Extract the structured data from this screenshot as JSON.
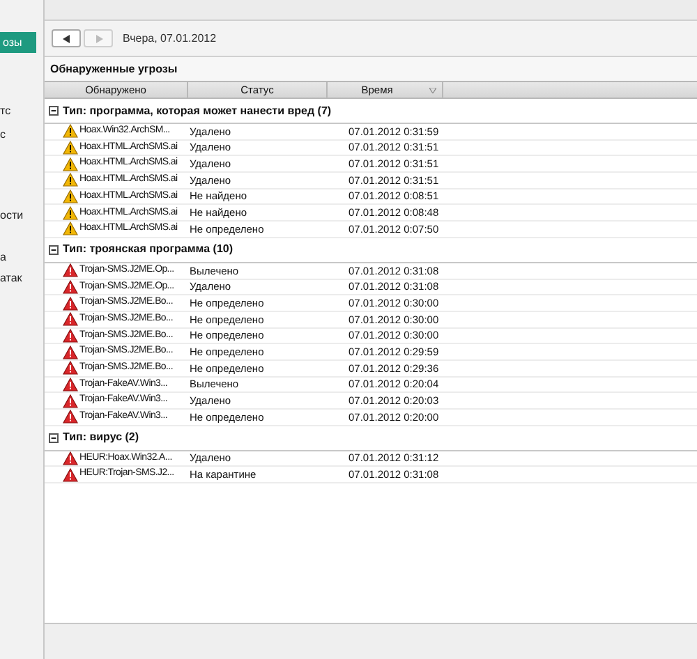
{
  "sidebar": {
    "items": [
      {
        "label": "озы",
        "selected": true
      },
      {
        "label": "тс",
        "selected": false
      },
      {
        "label": "с",
        "selected": false
      },
      {
        "label": "ости",
        "selected": false
      },
      {
        "label": "а",
        "selected": false
      },
      {
        "label": "атак",
        "selected": false
      }
    ]
  },
  "toolbar": {
    "date": "Вчера, 07.01.2012"
  },
  "panel": {
    "title": "Обнаруженные угрозы"
  },
  "table": {
    "columns": [
      "Обнаружено",
      "Статус",
      "Время"
    ],
    "groups": [
      {
        "title": "Тип: программа, которая может нанести вред (7)",
        "expanded": true,
        "rows": [
          {
            "kind": "warning",
            "name": "Hoax.Win32.ArchSM...",
            "status": "Удалено",
            "time": "07.01.2012 0:31:59"
          },
          {
            "kind": "warning",
            "name": "Hoax.HTML.ArchSMS.ai",
            "status": "Удалено",
            "time": "07.01.2012 0:31:51"
          },
          {
            "kind": "warning",
            "name": "Hoax.HTML.ArchSMS.ai",
            "status": "Удалено",
            "time": "07.01.2012 0:31:51"
          },
          {
            "kind": "warning",
            "name": "Hoax.HTML.ArchSMS.ai",
            "status": "Удалено",
            "time": "07.01.2012 0:31:51"
          },
          {
            "kind": "warning",
            "name": "Hoax.HTML.ArchSMS.ai",
            "status": "Не найдено",
            "time": "07.01.2012 0:08:51"
          },
          {
            "kind": "warning",
            "name": "Hoax.HTML.ArchSMS.ai",
            "status": "Не найдено",
            "time": "07.01.2012 0:08:48"
          },
          {
            "kind": "warning",
            "name": "Hoax.HTML.ArchSMS.ai",
            "status": "Не определено",
            "time": "07.01.2012 0:07:50"
          }
        ]
      },
      {
        "title": "Тип: троянская программа (10)",
        "expanded": true,
        "rows": [
          {
            "kind": "danger",
            "name": "Trojan-SMS.J2ME.Op...",
            "status": "Вылечено",
            "time": "07.01.2012 0:31:08"
          },
          {
            "kind": "danger",
            "name": "Trojan-SMS.J2ME.Op...",
            "status": "Удалено",
            "time": "07.01.2012 0:31:08"
          },
          {
            "kind": "danger",
            "name": "Trojan-SMS.J2ME.Bo...",
            "status": "Не определено",
            "time": "07.01.2012 0:30:00"
          },
          {
            "kind": "danger",
            "name": "Trojan-SMS.J2ME.Bo...",
            "status": "Не определено",
            "time": "07.01.2012 0:30:00"
          },
          {
            "kind": "danger",
            "name": "Trojan-SMS.J2ME.Bo...",
            "status": "Не определено",
            "time": "07.01.2012 0:30:00"
          },
          {
            "kind": "danger",
            "name": "Trojan-SMS.J2ME.Bo...",
            "status": "Не определено",
            "time": "07.01.2012 0:29:59"
          },
          {
            "kind": "danger",
            "name": "Trojan-SMS.J2ME.Bo...",
            "status": "Не определено",
            "time": "07.01.2012 0:29:36"
          },
          {
            "kind": "danger",
            "name": "Trojan-FakeAV.Win3...",
            "status": "Вылечено",
            "time": "07.01.2012 0:20:04"
          },
          {
            "kind": "danger",
            "name": "Trojan-FakeAV.Win3...",
            "status": "Удалено",
            "time": "07.01.2012 0:20:03"
          },
          {
            "kind": "danger",
            "name": "Trojan-FakeAV.Win3...",
            "status": "Не определено",
            "time": "07.01.2012 0:20:00"
          }
        ]
      },
      {
        "title": "Тип: вирус (2)",
        "expanded": true,
        "rows": [
          {
            "kind": "danger",
            "name": "HEUR:Hoax.Win32.A...",
            "status": "Удалено",
            "time": "07.01.2012 0:31:12"
          },
          {
            "kind": "danger",
            "name": "HEUR:Trojan-SMS.J2...",
            "status": "На карантине",
            "time": "07.01.2012 0:31:08"
          }
        ]
      }
    ]
  }
}
